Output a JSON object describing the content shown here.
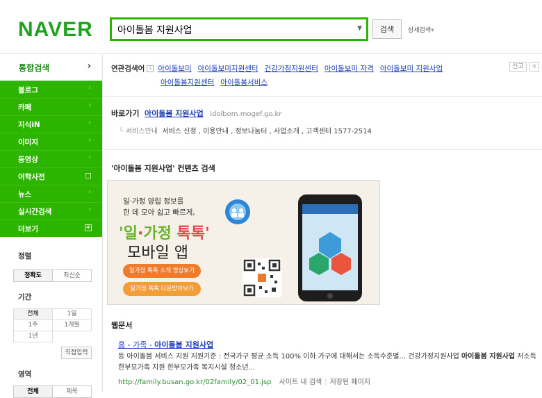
{
  "header": {
    "logo": "NAVER",
    "search_value": "아이돌봄 지원사업",
    "search_button": "검색",
    "advanced": "상세검색",
    "advanced_arrow": "▾"
  },
  "sidebar": {
    "top": "통합검색",
    "top_arrow": "›",
    "items": [
      {
        "label": "블로그",
        "mark": "›"
      },
      {
        "label": "카페",
        "mark": "›"
      },
      {
        "label": "지식iN",
        "mark": "›"
      },
      {
        "label": "이미지",
        "mark": "›"
      },
      {
        "label": "동영상",
        "mark": "›"
      },
      {
        "label": "어학사전",
        "mark": "square"
      },
      {
        "label": "뉴스",
        "mark": "›"
      },
      {
        "label": "실시간검색",
        "mark": "›"
      },
      {
        "label": "더보기",
        "mark": "+"
      }
    ],
    "sort": {
      "title": "정렬",
      "options": [
        "정확도",
        "최신순"
      ]
    },
    "period": {
      "title": "기간",
      "options": [
        "전체",
        "1일",
        "1주",
        "1개월",
        "1년"
      ],
      "direct": "직접입력"
    },
    "area": {
      "title": "영역",
      "options": [
        "전체",
        "제목"
      ]
    }
  },
  "related": {
    "label": "연관검색어",
    "help": "?",
    "links": [
      "아이돌보미",
      "아이돌보미지원센터",
      "건강가정지원센터",
      "아이돌보미 자격",
      "아이돌보미 지원사업",
      "아이돌봄지원센터",
      "아이돌봄서비스"
    ],
    "report": "신고",
    "close": "×"
  },
  "goto": {
    "label": "바로가기",
    "site": "아이돌봄 지원사업",
    "url": "idolbom.mogef.go.kr",
    "sub_label": "서비스안내",
    "sub_links": "서비스 신청 , 이용안내 , 정보나눔터 , 사업소개 ,",
    "phone": "고객센터 1577-2514"
  },
  "content": {
    "title": "'아이돌봄 지원사업' 컨텐츠 검색",
    "banner": {
      "line1": "일·가정 양립 정보를",
      "line2": "한 데 모아 쉽고 빠르게,",
      "title_a": "'일",
      "title_dot": "·",
      "title_b": "가정 ",
      "title_c": "톡톡'",
      "subtitle": "모바일 앱",
      "btn1": "일가정 톡톡 소개 영상보기",
      "btn2": "일가정 톡톡 다운받아보기"
    }
  },
  "web": {
    "title": "웹문서",
    "result": {
      "title_pre": "홈 - 가족 - ",
      "title_bold": "아이돌봄 지원사업",
      "desc_a": "등 아이돌봄 서비스 지원 지원기준 : 전국가구 평균 소득 100% 이하 가구에 대해서는 소득수준별... 건강가정지원사업 ",
      "desc_bold1": "아이돌봄 지원사업",
      "desc_b": " 저소득 한부모가족 지원 한부모가족 복지시설 청소년...",
      "url": "http://family.busan.go.kr/02family/02_01.jsp",
      "site_search": "사이트 내 검색",
      "cached": "저장된 페이지"
    }
  }
}
